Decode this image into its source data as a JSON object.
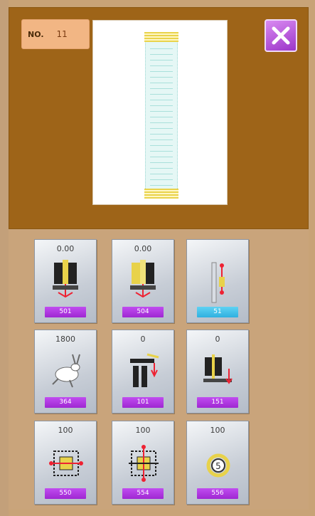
{
  "header": {
    "no_label": "NO.",
    "no_value": "11"
  },
  "tiles": [
    {
      "value": "0.00",
      "code": "501"
    },
    {
      "value": "0.00",
      "code": "504"
    },
    {
      "value": "",
      "code": "51"
    },
    {
      "value": "1800",
      "code": "364"
    },
    {
      "value": "0",
      "code": "101"
    },
    {
      "value": "0",
      "code": "151"
    },
    {
      "value": "100",
      "code": "550"
    },
    {
      "value": "100",
      "code": "554"
    },
    {
      "value": "100",
      "code": "556"
    }
  ],
  "colors": {
    "panel_brown": "#9e6418",
    "code_purple": "#b33be5",
    "code_cyan": "#2fb0e0",
    "close_purple": "#b35ad9"
  },
  "icons": {
    "close": "close-icon",
    "tile1": "presser-foot-left-icon",
    "tile2": "presser-foot-right-icon",
    "tile3": "needle-height-icon",
    "tile4": "rabbit-speed-icon",
    "tile5": "thread-tension-icon",
    "tile6": "feed-dog-icon",
    "tile7": "x-scale-icon",
    "tile8": "y-scale-icon",
    "tile9": "counter-icon"
  }
}
